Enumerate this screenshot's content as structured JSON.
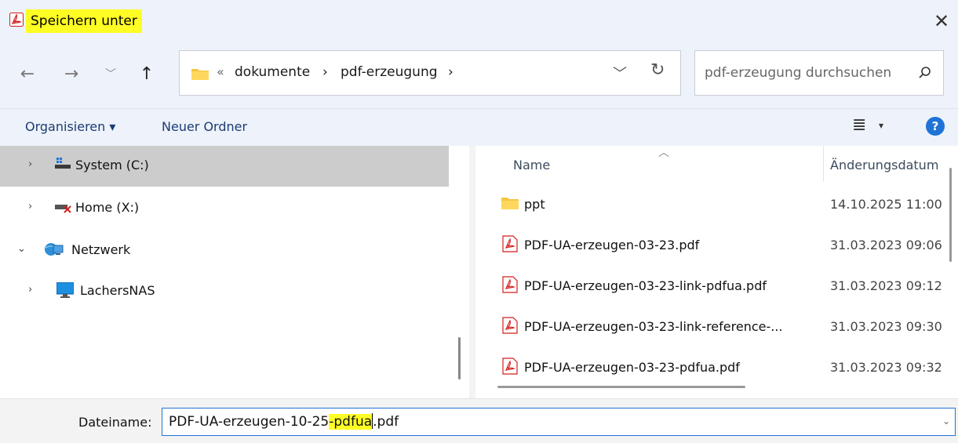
{
  "window": {
    "title": "Speichern unter",
    "close_glyph": "✕",
    "accent": "#1f73d6",
    "highlight": "#fffe24"
  },
  "nav": {
    "back_glyph": "←",
    "forward_glyph": "→",
    "recent_glyph": "﹀",
    "up_glyph": "↑",
    "address": {
      "overflow": "«",
      "crumbs": [
        "dokumente",
        "pdf-erzeugung"
      ],
      "sep": "›"
    },
    "refresh_glyph": "↻",
    "search_placeholder": "pdf-erzeugung durchsuchen"
  },
  "toolbar": {
    "organize": "Organisieren ▾",
    "new_folder": "Neuer Ordner",
    "view_glyph": "≣",
    "view_caret": "▾",
    "help": "?"
  },
  "sidebar": {
    "items": [
      {
        "label": "System (C:)",
        "chevron": "›",
        "icon": "drive-icon",
        "selected": true
      },
      {
        "label": "Home (X:)",
        "chevron": "›",
        "icon": "network-drive-disconnected-icon",
        "selected": false
      },
      {
        "label": "Netzwerk",
        "chevron": "⌄",
        "icon": "network-icon",
        "selected": false
      },
      {
        "label": "LachersNAS",
        "chevron": "›",
        "icon": "monitor-icon",
        "selected": false
      }
    ]
  },
  "files": {
    "columns": {
      "name": "Name",
      "date": "Änderungsdatum",
      "sort_glyph": "︿"
    },
    "rows": [
      {
        "name": "ppt",
        "date": "14.10.2025 11:00",
        "icon": "folder-icon"
      },
      {
        "name": "PDF-UA-erzeugen-03-23.pdf",
        "date": "31.03.2023 09:06",
        "icon": "pdf-icon"
      },
      {
        "name": "PDF-UA-erzeugen-03-23-link-pdfua.pdf",
        "date": "31.03.2023 09:12",
        "icon": "pdf-icon"
      },
      {
        "name": "PDF-UA-erzeugen-03-23-link-reference-...",
        "date": "31.03.2023 09:30",
        "icon": "pdf-icon"
      },
      {
        "name": "PDF-UA-erzeugen-03-23-pdfua.pdf",
        "date": "31.03.2023 09:32",
        "icon": "pdf-icon"
      }
    ]
  },
  "filename": {
    "label": "Dateiname:",
    "value_prefix": "PDF-UA-erzeugen-10-25",
    "value_highlight": "-pdfua",
    "value_suffix": ".pdf",
    "dropdown_glyph": "⌄"
  }
}
